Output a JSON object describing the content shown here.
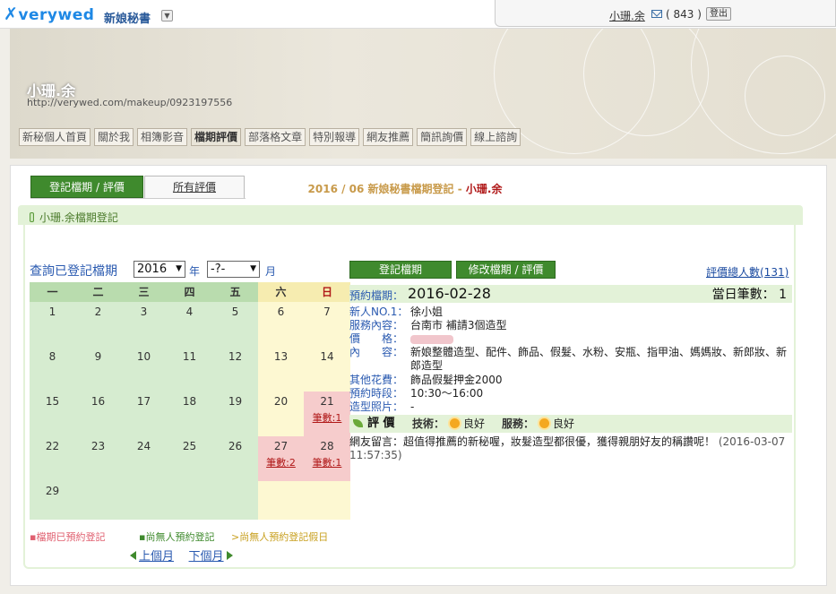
{
  "header": {
    "logo": "verywed",
    "section": "新娘秘書",
    "username": "小珊.余",
    "message_count": "( 843 )",
    "logout": "登出"
  },
  "banner": {
    "artist_name": "小珊.余",
    "url": "http://verywed.com/makeup/0923197556"
  },
  "nav": [
    {
      "label": "新秘個人首頁"
    },
    {
      "label": "關於我"
    },
    {
      "label": "相簿影音"
    },
    {
      "label": "檔期評價",
      "active": true
    },
    {
      "label": "部落格文章"
    },
    {
      "label": "特別報導"
    },
    {
      "label": "網友推薦"
    },
    {
      "label": "簡訊詢價"
    },
    {
      "label": "線上諮詢"
    }
  ],
  "tabs": {
    "register": "登記檔期 / 評價",
    "all_reviews": "所有評價"
  },
  "section_title": "小珊.余檔期登記",
  "calendar": {
    "title_prefix": "2016 / 06 新娘秘書檔期登記 - ",
    "title_name": "小珊.余",
    "query_label": "查詢已登記檔期",
    "year_value": "2016",
    "year_unit": "年",
    "month_value": "-?-",
    "month_unit": "月",
    "weekdays": [
      "一",
      "二",
      "三",
      "四",
      "五",
      "六",
      "日"
    ],
    "weeks": [
      [
        "1",
        "2",
        "3",
        "4",
        "5",
        "6",
        "7"
      ],
      [
        "8",
        "9",
        "10",
        "11",
        "12",
        "13",
        "14"
      ],
      [
        "15",
        "16",
        "17",
        "18",
        "19",
        "20",
        "21"
      ],
      [
        "22",
        "23",
        "24",
        "25",
        "26",
        "27",
        "28"
      ],
      [
        "29",
        "",
        "",
        "",
        "",
        "",
        ""
      ]
    ],
    "booked": [
      {
        "day": "21",
        "count_label": "筆數:1"
      },
      {
        "day": "27",
        "count_label": "筆數:2"
      },
      {
        "day": "28",
        "count_label": "筆數:1"
      }
    ],
    "legend": {
      "booked": "▪檔期已預約登記",
      "free": "▪尚無人預約登記",
      "free_holiday": ">尚無人預約登記假日"
    },
    "prev": "上個月",
    "next": "下個月"
  },
  "colors": {
    "weekday_bg": "#d6ecd0",
    "weekend_bg": "#fdf8d2",
    "booked_bg": "#f6cccc",
    "weekday_head": "#b9dcae",
    "weekend_head": "#f6ecb0",
    "green_button": "#3f8a2d",
    "legend_booked": "#e06070",
    "legend_free": "#3f8a2d",
    "legend_holiday": "#c8a020"
  },
  "actions": {
    "register": "登記檔期",
    "modify": "修改檔期 / 評價",
    "review_count": "評價總人數(131)"
  },
  "detail": {
    "booking_label": "預約檔期：",
    "booking_date": "2016-02-28",
    "day_count": "當日筆數： 1",
    "rows": [
      {
        "key": "新人NO.1：",
        "value": "徐小姐"
      },
      {
        "key": "服務內容：",
        "value": "台南市 補請3個造型"
      },
      {
        "key": "價　　格：",
        "value": ""
      },
      {
        "key": "內　　容：",
        "value": "新娘整體造型、配件、飾品、假髮、水粉、安瓶、指甲油、媽媽妝、新郎妝、新郎造型"
      },
      {
        "key": "其他花費：",
        "value": "飾品假髮押金2000"
      },
      {
        "key": "預約時段：",
        "value": "10:30～16:00"
      },
      {
        "key": "造型照片：",
        "value": "-"
      }
    ],
    "evaluation": {
      "label": "評 價",
      "skill_label": "技術：",
      "skill_value": "良好",
      "service_label": "服務：",
      "service_value": "良好"
    },
    "comment": "網友留言：超值得推薦的新秘喔，妝髮造型都很優，獲得親朋好友的稱讚呢！",
    "comment_time": "(2016-03-07 11:57:35)"
  }
}
